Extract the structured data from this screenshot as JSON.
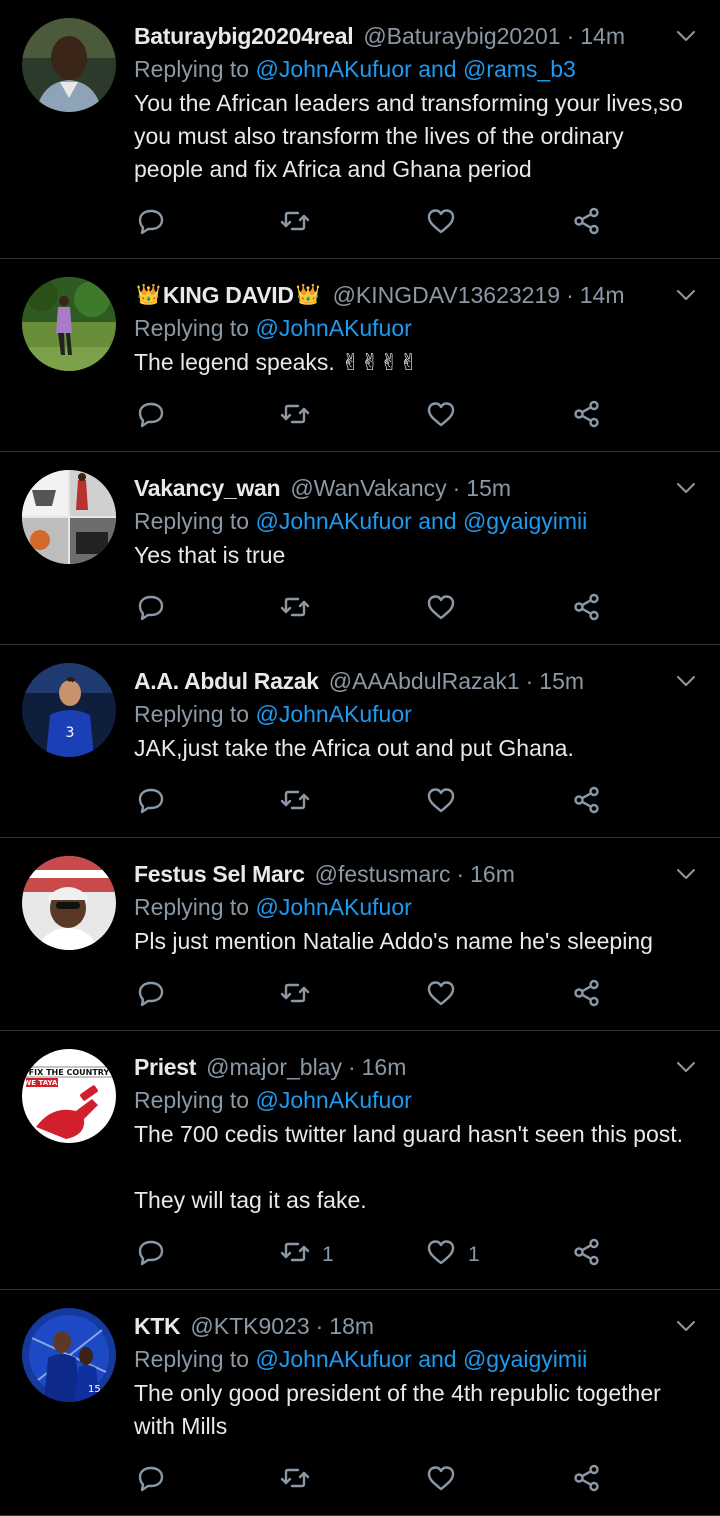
{
  "tweets": [
    {
      "name": "Baturaybig20204real",
      "name_suffix": "",
      "crowns": false,
      "handle": "@Baturaybig20201",
      "time": "14m",
      "replying_prefix": "Replying to",
      "mentions": [
        "@JohnAKufuor",
        "@rams_b3"
      ],
      "text": "You the African leaders and transforming your lives,so you must also transform the lives of the ordinary people and fix Africa and Ghana period",
      "retweets": "",
      "likes": "",
      "avatar": "man-portrait",
      "avatar_bg": "#2e3a2c"
    },
    {
      "name": "KING DAVID",
      "crowns": true,
      "crown_glyph": "👑",
      "handle": "@KINGDAV13623219",
      "time": "14m",
      "replying_prefix": "Replying to",
      "mentions": [
        "@JohnAKufuor"
      ],
      "text": "The legend speaks. ✌✌✌✌",
      "retweets": "",
      "likes": "",
      "avatar": "person-in-garden",
      "avatar_bg": "#3f6b2a"
    },
    {
      "name": "Vakancy_wan",
      "crowns": false,
      "handle": "@WanVakancy",
      "time": "15m",
      "replying_prefix": "Replying to",
      "mentions": [
        "@JohnAKufuor",
        "@gyaigyimii"
      ],
      "text": "Yes that is true",
      "retweets": "",
      "likes": "",
      "avatar": "collage",
      "avatar_bg": "#cfcfcf"
    },
    {
      "name": "A.A. Abdul Razak",
      "crowns": false,
      "handle": "@AAAbdulRazak1",
      "time": "15m",
      "replying_prefix": "Replying to",
      "mentions": [
        "@JohnAKufuor"
      ],
      "text": "JAK,just take the Africa out and put Ghana.",
      "retweets": "",
      "likes": "",
      "avatar": "footballer-blue-kit",
      "avatar_bg": "#0b1a3a"
    },
    {
      "name": "Festus Sel Marc",
      "crowns": false,
      "handle": "@festusmarc",
      "time": "16m",
      "replying_prefix": "Replying to",
      "mentions": [
        "@JohnAKufuor"
      ],
      "text": "Pls just mention Natalie Addo's name he's sleeping",
      "retweets": "",
      "likes": "",
      "avatar": "man-with-cap",
      "avatar_bg": "#d9d9d9"
    },
    {
      "name": "Priest",
      "crowns": false,
      "handle": "@major_blay",
      "time": "16m",
      "replying_prefix": "Replying to",
      "mentions": [
        "@JohnAKufuor"
      ],
      "text": "The 700 cedis twitter land guard hasn't seen this post.\n\nThey will tag it as fake.",
      "retweets": "1",
      "likes": "1",
      "avatar": "fix-the-country-logo",
      "avatar_text_1": "FIX THE COUNTRY",
      "avatar_text_2": "WE TAYA!",
      "avatar_bg": "#ffffff"
    },
    {
      "name": "KTK",
      "crowns": false,
      "handle": "@KTK9023",
      "time": "18m",
      "replying_prefix": "Replying to",
      "mentions": [
        "@JohnAKufuor",
        "@gyaigyimii"
      ],
      "text": "The only good president of the 4th republic together with Mills",
      "retweets": "",
      "likes": "",
      "avatar": "chelsea-players",
      "avatar_bg": "#1a3fa8"
    }
  ],
  "and_word": "and",
  "separator": "·",
  "colors": {
    "background": "#000000",
    "primary_text": "#e7e9ea",
    "secondary_text": "#8b98a5",
    "link": "#1d9bf0",
    "divider": "#2f3336"
  },
  "icons": {
    "reply": "reply-icon",
    "retweet": "retweet-icon",
    "like": "heart-icon",
    "share": "share-icon",
    "menu": "chevron-down-icon"
  }
}
